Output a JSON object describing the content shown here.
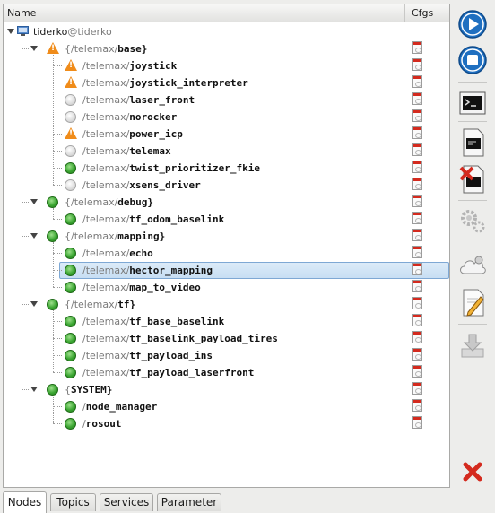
{
  "header": {
    "name_col": "Name",
    "cfgs_col": "Cfgs"
  },
  "host": {
    "name": "tiderko",
    "at": "@tiderko"
  },
  "rows": [
    {
      "kind": "group",
      "ns": "{/telemax/",
      "nm": "base",
      "close": "}",
      "status": "warn"
    },
    {
      "kind": "node",
      "ns": "/telemax/",
      "nm": "joystick",
      "status": "warn"
    },
    {
      "kind": "node",
      "ns": "/telemax/",
      "nm": "joystick_interpreter",
      "status": "warn"
    },
    {
      "kind": "node",
      "ns": "/telemax/",
      "nm": "laser_front",
      "status": "off"
    },
    {
      "kind": "node",
      "ns": "/telemax/",
      "nm": "norocker",
      "status": "off"
    },
    {
      "kind": "node",
      "ns": "/telemax/",
      "nm": "power_icp",
      "status": "warn"
    },
    {
      "kind": "node",
      "ns": "/telemax/",
      "nm": "telemax",
      "status": "off"
    },
    {
      "kind": "node",
      "ns": "/telemax/",
      "nm": "twist_prioritizer_fkie",
      "status": "ok"
    },
    {
      "kind": "node",
      "ns": "/telemax/",
      "nm": "xsens_driver",
      "status": "off"
    },
    {
      "kind": "group",
      "ns": "{/telemax/",
      "nm": "debug",
      "close": "}",
      "status": "ok"
    },
    {
      "kind": "node",
      "ns": "/telemax/",
      "nm": "tf_odom_baselink",
      "status": "ok"
    },
    {
      "kind": "group",
      "ns": "{/telemax/",
      "nm": "mapping",
      "close": "}",
      "status": "ok"
    },
    {
      "kind": "node",
      "ns": "/telemax/",
      "nm": "echo",
      "status": "ok"
    },
    {
      "kind": "node",
      "ns": "/telemax/",
      "nm": "hector_mapping",
      "status": "ok",
      "selected": true
    },
    {
      "kind": "node",
      "ns": "/telemax/",
      "nm": "map_to_video",
      "status": "ok"
    },
    {
      "kind": "group",
      "ns": "{/telemax/",
      "nm": "tf",
      "close": "}",
      "status": "ok"
    },
    {
      "kind": "node",
      "ns": "/telemax/",
      "nm": "tf_base_baselink",
      "status": "ok"
    },
    {
      "kind": "node",
      "ns": "/telemax/",
      "nm": "tf_baselink_payload_tires",
      "status": "ok"
    },
    {
      "kind": "node",
      "ns": "/telemax/",
      "nm": "tf_payload_ins",
      "status": "ok"
    },
    {
      "kind": "node",
      "ns": "/telemax/",
      "nm": "tf_payload_laserfront",
      "status": "ok"
    },
    {
      "kind": "group",
      "ns": "{",
      "nm": "SYSTEM",
      "close": "}",
      "status": "ok"
    },
    {
      "kind": "node",
      "ns": "/",
      "nm": "node_manager",
      "status": "ok"
    },
    {
      "kind": "node",
      "ns": "/",
      "nm": "rosout",
      "status": "ok"
    }
  ],
  "toolbar": [
    {
      "icon": "play-icon",
      "name": "start-button"
    },
    {
      "icon": "stop-icon",
      "name": "stop-button"
    },
    {
      "icon": "terminal-icon",
      "name": "screen-button"
    },
    {
      "icon": "log-icon",
      "name": "log-button"
    },
    {
      "icon": "clear-log-icon",
      "name": "clear-log-button"
    },
    {
      "icon": "gears-icon",
      "name": "configure-button"
    },
    {
      "icon": "cloud-icon",
      "name": "cloud-button"
    },
    {
      "icon": "edit-icon",
      "name": "edit-button"
    },
    {
      "icon": "download-icon",
      "name": "save-button"
    },
    {
      "icon": "close-icon",
      "name": "close-button"
    }
  ],
  "tabs": [
    "Nodes",
    "Topics",
    "Services",
    "Parameter"
  ],
  "colors": {
    "accent": "#1f6fc0",
    "selection": "#c7def3",
    "ok": "#3aa531",
    "warn": "#f08c1a",
    "error": "#d42a1e"
  }
}
